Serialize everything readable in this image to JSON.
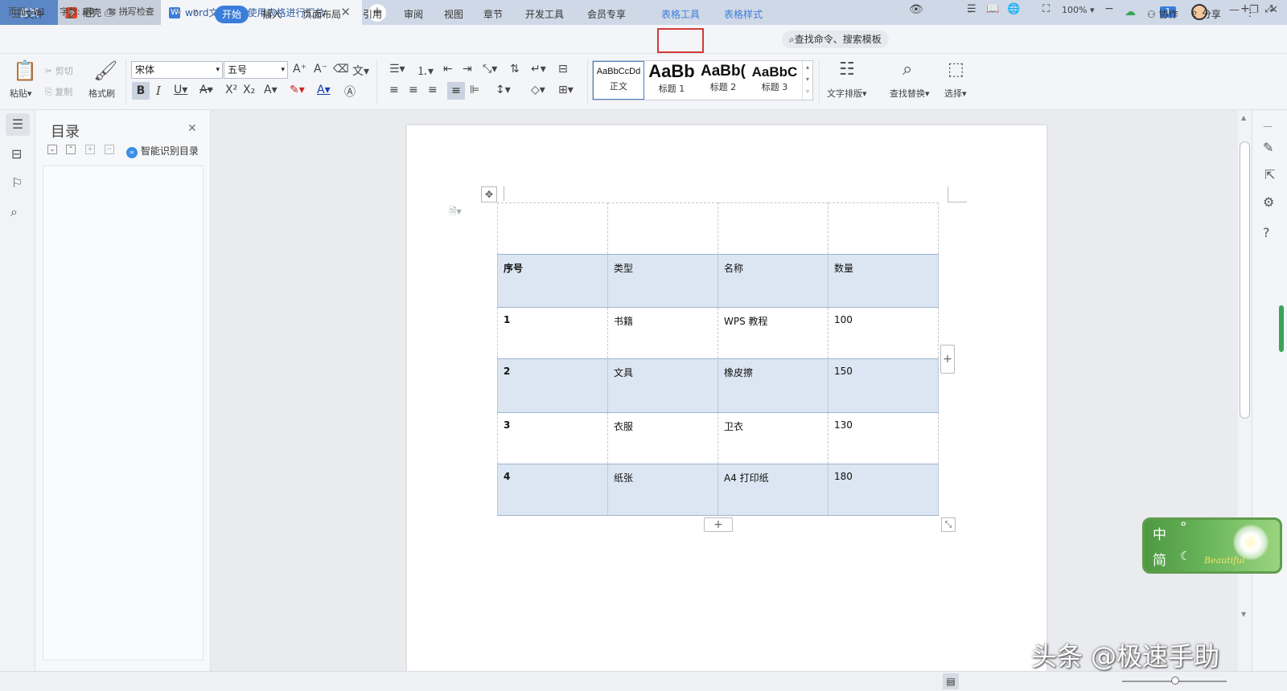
{
  "titlebar": {
    "tabs": [
      {
        "label": "首页"
      },
      {
        "label": "稻壳"
      },
      {
        "label": "word文档怎么使用表格进行汇总"
      }
    ],
    "badge": "1"
  },
  "menubar": {
    "file": "文件",
    "items": [
      "开始",
      "插入",
      "页面布局",
      "引用",
      "审阅",
      "视图",
      "章节",
      "开发工具",
      "会员专享",
      "表格工具",
      "表格样式"
    ],
    "search": "查找命令、搜索模板",
    "collab": "协作",
    "share": "分享"
  },
  "ribbon": {
    "paste": "粘贴",
    "cut": "剪切",
    "copy": "复制",
    "format_painter": "格式刷",
    "font_name": "宋体",
    "font_size": "五号",
    "styles": [
      {
        "sample": "AaBbCcDd",
        "label": "正文"
      },
      {
        "sample": "AaBb",
        "label": "标题 1"
      },
      {
        "sample": "AaBb(",
        "label": "标题 2"
      },
      {
        "sample": "AaBbC",
        "label": "标题 3"
      }
    ],
    "text_layout": "文字排版",
    "find_replace": "查找替换",
    "select": "选择"
  },
  "toc": {
    "title": "目录",
    "smart": "智能识别目录"
  },
  "table": {
    "headers": [
      "序号",
      "类型",
      "名称",
      "数量"
    ],
    "rows": [
      [
        "1",
        "书籍",
        "WPS 教程",
        "100"
      ],
      [
        "2",
        "文具",
        "橡皮擦",
        "150"
      ],
      [
        "3",
        "衣服",
        "卫衣",
        "130"
      ],
      [
        "4",
        "纸张",
        "A4 打印纸",
        "180"
      ]
    ]
  },
  "status": {
    "page": "页面: 1/1",
    "words": "字数: 36",
    "spell": "拼写检查",
    "zoom": "100%"
  },
  "ime": {
    "zh": "中",
    "jian": "简",
    "brand": "Beautiful"
  },
  "watermark": "头条 @极速手助",
  "colors": {
    "accent": "#3a7ddb",
    "table_fill": "#dce6f2",
    "highlight_box": "#d23a3a"
  }
}
